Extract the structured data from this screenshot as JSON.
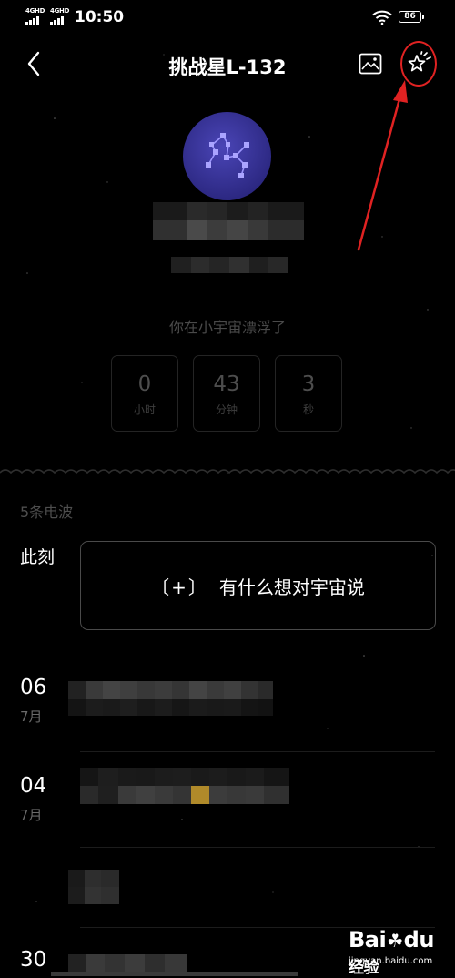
{
  "status_bar": {
    "signal_1": "4GHD",
    "signal_2": "4GHD",
    "time": "10:50",
    "battery": "86"
  },
  "header": {
    "title": "挑战星L-132",
    "back_icon": "chevron-left-icon",
    "image_icon": "image-icon",
    "sparkle_icon": "sparkle-star-icon"
  },
  "timer": {
    "caption": "你在小宇宙漂浮了",
    "hours": "0",
    "hours_unit": "小时",
    "minutes": "43",
    "minutes_unit": "分钟",
    "seconds": "3",
    "seconds_unit": "秒"
  },
  "feed": {
    "count_label": "5条电波",
    "now_label": "此刻",
    "compose_plus": "〔+〕",
    "compose_text": "有什么想对宇宙说",
    "entries": [
      {
        "day": "06",
        "month": "7月"
      },
      {
        "day": "04",
        "month": "7月"
      },
      {
        "day": "30",
        "month": ""
      }
    ]
  },
  "watermark": {
    "brand": "Bai",
    "brand_end": "du",
    "jingyan": "经验",
    "url": "jingyan.baidu.com"
  },
  "colors": {
    "background": "#000000",
    "avatar": "#3a35a0",
    "annotation": "#e02222",
    "mosaic_gold": "#b08a2a"
  }
}
